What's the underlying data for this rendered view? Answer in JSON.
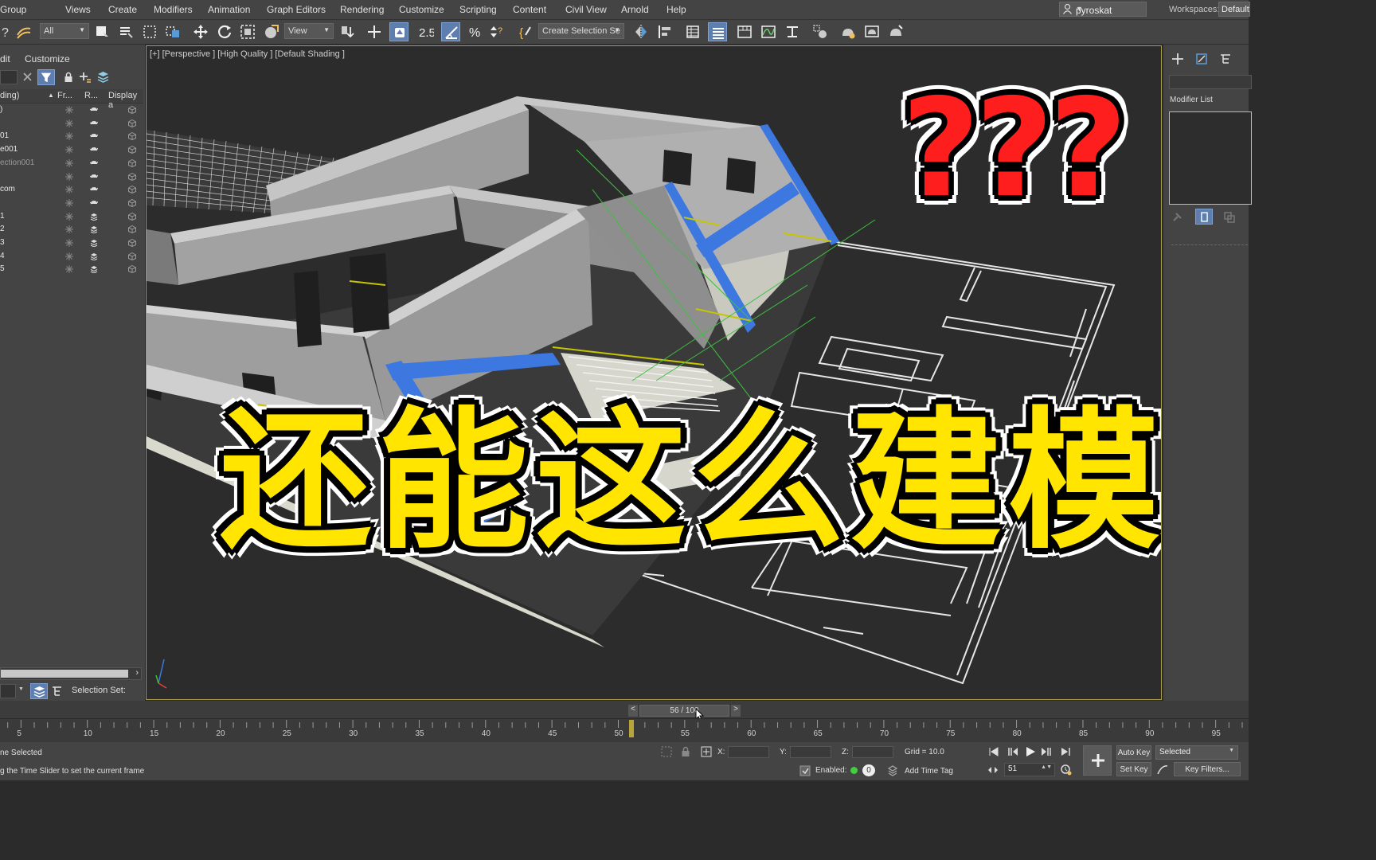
{
  "menu": [
    "Group",
    "Views",
    "Create",
    "Modifiers",
    "Animation",
    "Graph Editors",
    "Rendering",
    "Customize",
    "Scripting",
    "Content",
    "Civil View",
    "Arnold",
    "Help"
  ],
  "user": "pyroskat",
  "workspaces_label": "Workspaces:",
  "workspace_value": "Default",
  "toolbar": {
    "filter_value": "All",
    "refcoord_value": "View",
    "snap_label": "2.5",
    "selection_set_value": "Create Selection Se"
  },
  "scene_explorer": {
    "menu_edit": "dit",
    "menu_customize": "Customize",
    "col_name": "ding)",
    "col_freeze": "Fr...",
    "col_render": "R...",
    "col_display": "Display a",
    "rows": [
      ")",
      "",
      "01",
      "e001",
      "ection001",
      "",
      "com",
      "",
      "1",
      "2",
      "3",
      "4",
      "5"
    ],
    "selection_set_label": "Selection Set:"
  },
  "viewport": {
    "label": "[+] [Perspective ] [High Quality ] [Default Shading ]",
    "overlay_title": "还能这么建模?",
    "overlay_marks": "???"
  },
  "command_panel": {
    "modifier_list": "Modifier List"
  },
  "time_slider": {
    "position": "56 / 100",
    "prev": "<",
    "next": ">",
    "current_frame": 56,
    "total_frames": 100
  },
  "track_ticks": [
    "5",
    "10",
    "15",
    "20",
    "25",
    "30",
    "35",
    "40",
    "45",
    "50",
    "55",
    "60",
    "65",
    "70",
    "75",
    "80",
    "85",
    "90",
    "95"
  ],
  "status": {
    "selected_text": "ne Selected",
    "prompt_text": "g the Time Slider to set the current frame",
    "x_label": "X:",
    "y_label": "Y:",
    "z_label": "Z:",
    "grid": "Grid = 10.0",
    "enabled_label": "Enabled:",
    "add_time_tag": "Add Time Tag",
    "frame_value": "51",
    "auto_key": "Auto Key",
    "set_key": "Set Key",
    "selected_dropdown": "Selected",
    "key_filters": "Key Filters..."
  },
  "colors": {
    "accent_blue": "#5d7eae",
    "viewport_border": "#a89c48",
    "overlay_yellow": "#ffe500",
    "overlay_red": "#ff1e1e",
    "wall_blue": "#3c78e0"
  }
}
